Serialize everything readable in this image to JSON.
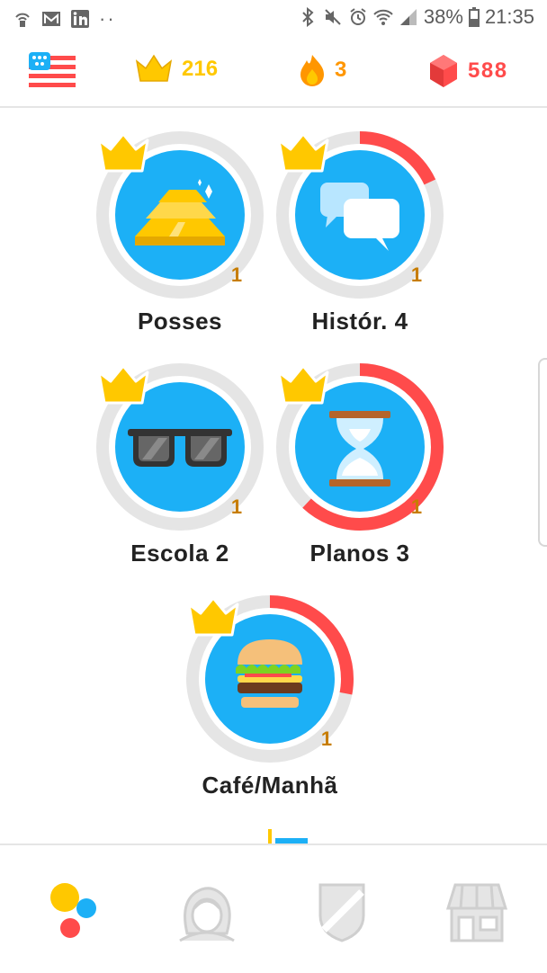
{
  "statusbar": {
    "battery": "38%",
    "time": "21:35"
  },
  "header": {
    "crowns": "216",
    "streak": "3",
    "gems": "588"
  },
  "skills": [
    {
      "name": "Posses",
      "level": "1",
      "progress": 0
    },
    {
      "name": "Histór. 4",
      "level": "1",
      "progress": 0.18
    },
    {
      "name": "Escola 2",
      "level": "1",
      "progress": 0
    },
    {
      "name": "Planos 3",
      "level": "1",
      "progress": 0.62
    },
    {
      "name": "Café/Manhã",
      "level": "1",
      "progress": 0.28
    }
  ],
  "colors": {
    "accent": "#1cb0f6",
    "gold": "#ffc800",
    "streak": "#ff9600",
    "gems": "#ff4b4b",
    "ring_bg": "#e5e5e5",
    "ring_fill": "#ff4b4b"
  },
  "nav": {
    "items": [
      "learn-icon",
      "profile-icon",
      "leagues-icon",
      "shop-icon"
    ]
  }
}
